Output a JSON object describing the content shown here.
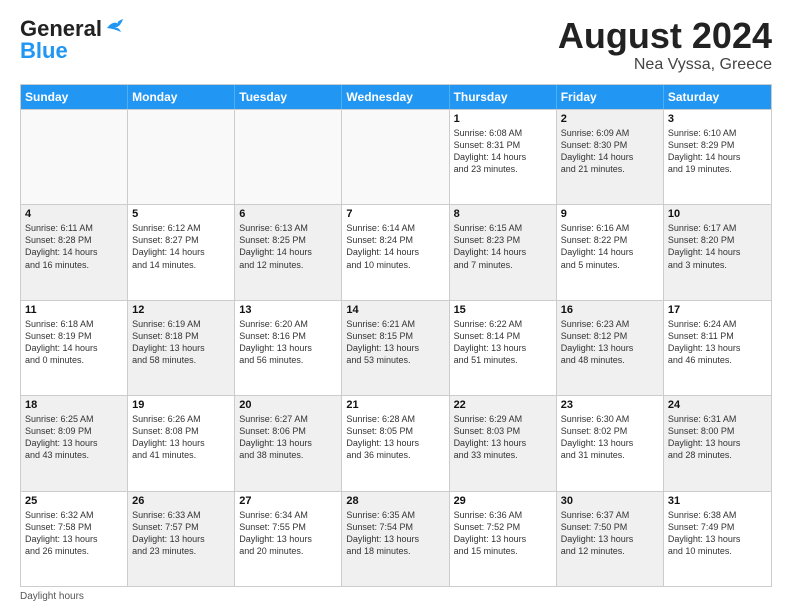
{
  "header": {
    "logo_line1": "General",
    "logo_line2": "Blue",
    "month_year": "August 2024",
    "location": "Nea Vyssa, Greece"
  },
  "weekdays": [
    "Sunday",
    "Monday",
    "Tuesday",
    "Wednesday",
    "Thursday",
    "Friday",
    "Saturday"
  ],
  "footer": {
    "note": "Daylight hours"
  },
  "weeks": [
    [
      {
        "day": "",
        "info": "",
        "shaded": false,
        "empty": true
      },
      {
        "day": "",
        "info": "",
        "shaded": false,
        "empty": true
      },
      {
        "day": "",
        "info": "",
        "shaded": false,
        "empty": true
      },
      {
        "day": "",
        "info": "",
        "shaded": false,
        "empty": true
      },
      {
        "day": "1",
        "info": "Sunrise: 6:08 AM\nSunset: 8:31 PM\nDaylight: 14 hours\nand 23 minutes.",
        "shaded": false,
        "empty": false
      },
      {
        "day": "2",
        "info": "Sunrise: 6:09 AM\nSunset: 8:30 PM\nDaylight: 14 hours\nand 21 minutes.",
        "shaded": true,
        "empty": false
      },
      {
        "day": "3",
        "info": "Sunrise: 6:10 AM\nSunset: 8:29 PM\nDaylight: 14 hours\nand 19 minutes.",
        "shaded": false,
        "empty": false
      }
    ],
    [
      {
        "day": "4",
        "info": "Sunrise: 6:11 AM\nSunset: 8:28 PM\nDaylight: 14 hours\nand 16 minutes.",
        "shaded": true,
        "empty": false
      },
      {
        "day": "5",
        "info": "Sunrise: 6:12 AM\nSunset: 8:27 PM\nDaylight: 14 hours\nand 14 minutes.",
        "shaded": false,
        "empty": false
      },
      {
        "day": "6",
        "info": "Sunrise: 6:13 AM\nSunset: 8:25 PM\nDaylight: 14 hours\nand 12 minutes.",
        "shaded": true,
        "empty": false
      },
      {
        "day": "7",
        "info": "Sunrise: 6:14 AM\nSunset: 8:24 PM\nDaylight: 14 hours\nand 10 minutes.",
        "shaded": false,
        "empty": false
      },
      {
        "day": "8",
        "info": "Sunrise: 6:15 AM\nSunset: 8:23 PM\nDaylight: 14 hours\nand 7 minutes.",
        "shaded": true,
        "empty": false
      },
      {
        "day": "9",
        "info": "Sunrise: 6:16 AM\nSunset: 8:22 PM\nDaylight: 14 hours\nand 5 minutes.",
        "shaded": false,
        "empty": false
      },
      {
        "day": "10",
        "info": "Sunrise: 6:17 AM\nSunset: 8:20 PM\nDaylight: 14 hours\nand 3 minutes.",
        "shaded": true,
        "empty": false
      }
    ],
    [
      {
        "day": "11",
        "info": "Sunrise: 6:18 AM\nSunset: 8:19 PM\nDaylight: 14 hours\nand 0 minutes.",
        "shaded": false,
        "empty": false
      },
      {
        "day": "12",
        "info": "Sunrise: 6:19 AM\nSunset: 8:18 PM\nDaylight: 13 hours\nand 58 minutes.",
        "shaded": true,
        "empty": false
      },
      {
        "day": "13",
        "info": "Sunrise: 6:20 AM\nSunset: 8:16 PM\nDaylight: 13 hours\nand 56 minutes.",
        "shaded": false,
        "empty": false
      },
      {
        "day": "14",
        "info": "Sunrise: 6:21 AM\nSunset: 8:15 PM\nDaylight: 13 hours\nand 53 minutes.",
        "shaded": true,
        "empty": false
      },
      {
        "day": "15",
        "info": "Sunrise: 6:22 AM\nSunset: 8:14 PM\nDaylight: 13 hours\nand 51 minutes.",
        "shaded": false,
        "empty": false
      },
      {
        "day": "16",
        "info": "Sunrise: 6:23 AM\nSunset: 8:12 PM\nDaylight: 13 hours\nand 48 minutes.",
        "shaded": true,
        "empty": false
      },
      {
        "day": "17",
        "info": "Sunrise: 6:24 AM\nSunset: 8:11 PM\nDaylight: 13 hours\nand 46 minutes.",
        "shaded": false,
        "empty": false
      }
    ],
    [
      {
        "day": "18",
        "info": "Sunrise: 6:25 AM\nSunset: 8:09 PM\nDaylight: 13 hours\nand 43 minutes.",
        "shaded": true,
        "empty": false
      },
      {
        "day": "19",
        "info": "Sunrise: 6:26 AM\nSunset: 8:08 PM\nDaylight: 13 hours\nand 41 minutes.",
        "shaded": false,
        "empty": false
      },
      {
        "day": "20",
        "info": "Sunrise: 6:27 AM\nSunset: 8:06 PM\nDaylight: 13 hours\nand 38 minutes.",
        "shaded": true,
        "empty": false
      },
      {
        "day": "21",
        "info": "Sunrise: 6:28 AM\nSunset: 8:05 PM\nDaylight: 13 hours\nand 36 minutes.",
        "shaded": false,
        "empty": false
      },
      {
        "day": "22",
        "info": "Sunrise: 6:29 AM\nSunset: 8:03 PM\nDaylight: 13 hours\nand 33 minutes.",
        "shaded": true,
        "empty": false
      },
      {
        "day": "23",
        "info": "Sunrise: 6:30 AM\nSunset: 8:02 PM\nDaylight: 13 hours\nand 31 minutes.",
        "shaded": false,
        "empty": false
      },
      {
        "day": "24",
        "info": "Sunrise: 6:31 AM\nSunset: 8:00 PM\nDaylight: 13 hours\nand 28 minutes.",
        "shaded": true,
        "empty": false
      }
    ],
    [
      {
        "day": "25",
        "info": "Sunrise: 6:32 AM\nSunset: 7:58 PM\nDaylight: 13 hours\nand 26 minutes.",
        "shaded": false,
        "empty": false
      },
      {
        "day": "26",
        "info": "Sunrise: 6:33 AM\nSunset: 7:57 PM\nDaylight: 13 hours\nand 23 minutes.",
        "shaded": true,
        "empty": false
      },
      {
        "day": "27",
        "info": "Sunrise: 6:34 AM\nSunset: 7:55 PM\nDaylight: 13 hours\nand 20 minutes.",
        "shaded": false,
        "empty": false
      },
      {
        "day": "28",
        "info": "Sunrise: 6:35 AM\nSunset: 7:54 PM\nDaylight: 13 hours\nand 18 minutes.",
        "shaded": true,
        "empty": false
      },
      {
        "day": "29",
        "info": "Sunrise: 6:36 AM\nSunset: 7:52 PM\nDaylight: 13 hours\nand 15 minutes.",
        "shaded": false,
        "empty": false
      },
      {
        "day": "30",
        "info": "Sunrise: 6:37 AM\nSunset: 7:50 PM\nDaylight: 13 hours\nand 12 minutes.",
        "shaded": true,
        "empty": false
      },
      {
        "day": "31",
        "info": "Sunrise: 6:38 AM\nSunset: 7:49 PM\nDaylight: 13 hours\nand 10 minutes.",
        "shaded": false,
        "empty": false
      }
    ]
  ]
}
